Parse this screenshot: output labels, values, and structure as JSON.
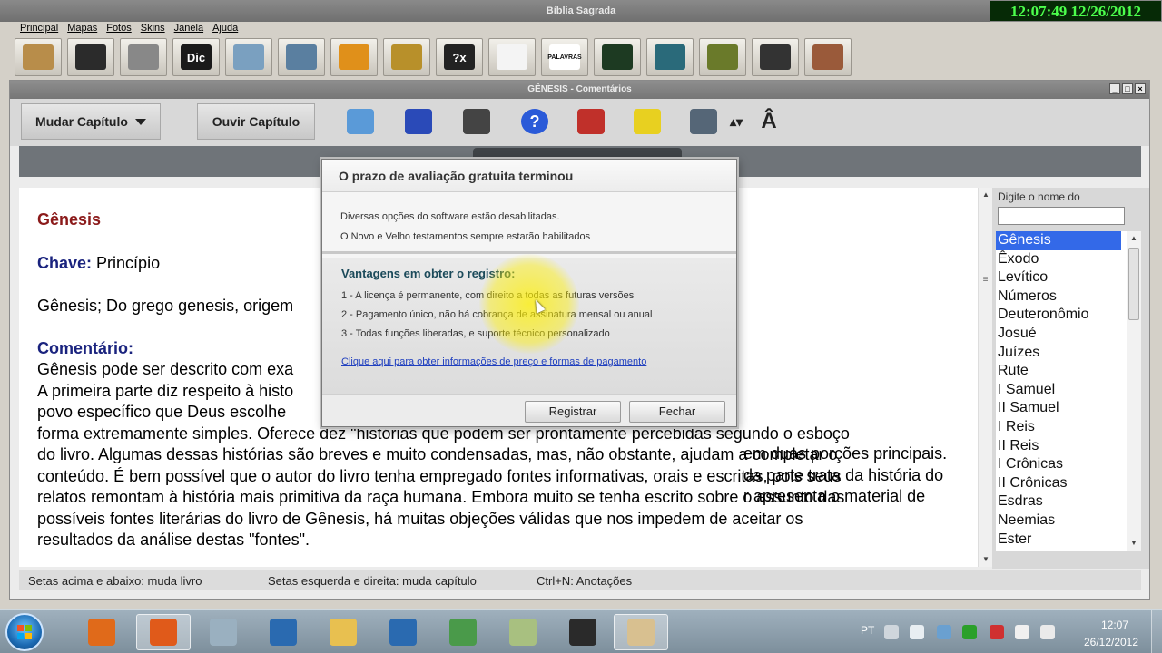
{
  "app": {
    "title": "Bíblia Sagrada",
    "clock": "12:07:49  12/26/2012",
    "menu": [
      "Principal",
      "Mapas",
      "Fotos",
      "Skins",
      "Janela",
      "Ajuda"
    ],
    "toolbar_icons": [
      {
        "name": "bible-book-icon",
        "color": "#b88d4a"
      },
      {
        "name": "binoculars-icon",
        "color": "#2b2b2b"
      },
      {
        "name": "magnifier-search-icon",
        "color": "#888888"
      },
      {
        "name": "dictionary-icon",
        "color": "#1a1a1a",
        "text": "Dic"
      },
      {
        "name": "map-icon",
        "color": "#7aa0c0"
      },
      {
        "name": "photos-icon",
        "color": "#5a7fa0"
      },
      {
        "name": "praying-person-icon",
        "color": "#e0901a"
      },
      {
        "name": "cross-figure-icon",
        "color": "#b8902a"
      },
      {
        "name": "quiz-icon",
        "color": "#222222",
        "text": "?x"
      },
      {
        "name": "checklist-icon",
        "color": "#f4f4f4"
      },
      {
        "name": "word-puzzle-icon",
        "color": "#ffffff",
        "text": "PALAVRAS"
      },
      {
        "name": "christmas-tree-icon",
        "color": "#1d3a22"
      },
      {
        "name": "landscape-icon",
        "color": "#2a6a7a"
      },
      {
        "name": "jar-icon",
        "color": "#6a7a2a"
      },
      {
        "name": "stopwatch-icon",
        "color": "#333333"
      },
      {
        "name": "treasure-chest-icon",
        "color": "#9a5a3a"
      }
    ]
  },
  "window": {
    "title": "GÊNESIS - Comentários",
    "controls": [
      "_",
      "□",
      "×"
    ],
    "mudar_capitulo": "Mudar Capítulo",
    "ouvir_capitulo": "Ouvir Capítulo",
    "tools": [
      {
        "name": "notebook-icon",
        "color": "#5a9ad8"
      },
      {
        "name": "word-document-icon",
        "color": "#2a4ab8"
      },
      {
        "name": "printer-icon",
        "color": "#444444"
      },
      {
        "name": "help-icon",
        "color": "#2a5ad8",
        "text": "?"
      },
      {
        "name": "alarm-lights-icon",
        "color": "#c0302a"
      },
      {
        "name": "tag-note-icon",
        "color": "#e8d020"
      },
      {
        "name": "copy-icon",
        "color": "#556677"
      },
      {
        "name": "font-size-arrows-icon",
        "color": "#222222",
        "text": "▴▾"
      },
      {
        "name": "font-increase-icon",
        "color": "#222222",
        "text": "Â"
      }
    ]
  },
  "content": {
    "book_title": "Gênesis",
    "key_label": "Chave:",
    "key_value": "Princípio",
    "origin": "Gênesis; Do grego genesis, origem",
    "comment_label": "Comentário:",
    "comment_lines": [
      "Gênesis pode ser descrito com exa",
      "A primeira parte diz respeito à histo",
      "povo específico que Deus escolhe",
      "forma extremamente simples. Oferece dez \"histórias que podem ser prontamente percebidas segundo o esboço",
      "do livro. Algumas dessas histórias são breves e muito condensadas, mas, não obstante, ajudam a completar o",
      "conteúdo. É bem possível que o autor do livro tenha empregado fontes informativas, orais e escritas, pois seus",
      "relatos remontam à história mais primitiva da raça humana. Embora muito se tenha escrito sobre o assunto das",
      "possíveis fontes literárias do livro de Gênesis, há muitas objeções válidas que nos impedem de aceitar os",
      "resultados da análise destas \"fontes\"."
    ],
    "right_fragments": [
      "em duas porções principais.",
      "da parte trata da história do",
      "r apresenta o material de"
    ]
  },
  "book_panel": {
    "prompt": "Digite o nome do",
    "search_value": "",
    "selected": "Gênesis",
    "books": [
      "Gênesis",
      "Êxodo",
      "Levítico",
      "Números",
      "Deuteronômio",
      "Josué",
      "Juízes",
      "Rute",
      "I Samuel",
      "II Samuel",
      "I Reis",
      "II Reis",
      "I Crônicas",
      "II Crônicas",
      "Esdras",
      "Neemias",
      "Ester"
    ]
  },
  "status": {
    "up_down": "Setas acima e abaixo: muda livro",
    "left_right": "Setas esquerda e direita: muda capítulo",
    "notes": "Ctrl+N: Anotações"
  },
  "dialog": {
    "title": "O prazo de avaliação gratuita terminou",
    "msg1": "Diversas opções do software estão desabilitadas.",
    "msg2": "O Novo e Velho testamentos sempre estarão habilitados",
    "advantages_title": "Vantagens em obter o registro:",
    "advantages": [
      "1 - A licença é permanente, com direito a todas as futuras versões",
      "2 - Pagamento único, não há cobrança de assinatura mensal ou anual",
      "3 - Todas funções liberadas, e suporte técnico personalizado"
    ],
    "link": "Clique aqui para obter informações de preço e formas de pagamento",
    "register_button": "Registrar",
    "close_button": "Fechar"
  },
  "taskbar": {
    "apps": [
      {
        "name": "media-player-icon",
        "color": "#e06a1a",
        "active": false
      },
      {
        "name": "firefox-icon",
        "color": "#e05a1a",
        "active": true
      },
      {
        "name": "calculator-icon",
        "color": "#9ab0c0",
        "active": false
      },
      {
        "name": "app-window-icon",
        "color": "#2a6ab0",
        "active": false
      },
      {
        "name": "folder-icon",
        "color": "#e8c050",
        "active": false
      },
      {
        "name": "app-window-icon",
        "color": "#2a6ab0",
        "active": false
      },
      {
        "name": "users-icon",
        "color": "#4a9a4a",
        "active": false
      },
      {
        "name": "notepad-icon",
        "color": "#a8c080",
        "active": false
      },
      {
        "name": "camera-icon",
        "color": "#2a2a2a",
        "active": false
      },
      {
        "name": "bible-app-icon",
        "color": "#d8c090",
        "active": true
      }
    ],
    "language": "PT",
    "time": "12:07",
    "date": "26/12/2012"
  }
}
